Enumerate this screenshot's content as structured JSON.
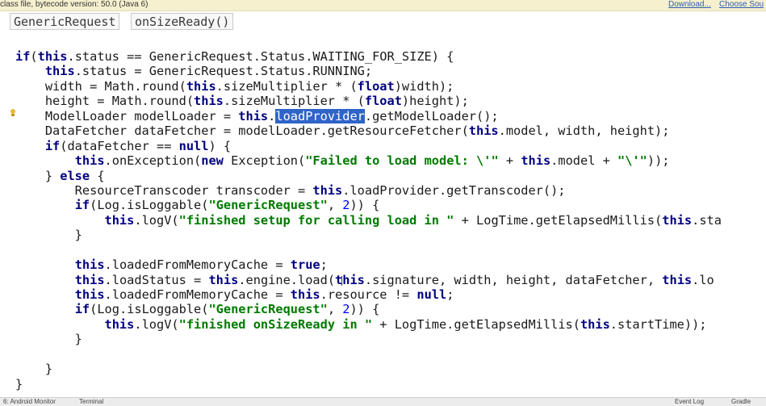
{
  "notice": {
    "message": "class file, bytecode version: 50.0 (Java 6)",
    "download_label": "Download...",
    "choose_sources_label": "Choose Sou"
  },
  "breadcrumb": [
    "GenericRequest",
    "onSizeReady()"
  ],
  "code_lines": [
    [
      [
        "if",
        "kw"
      ],
      [
        "(",
        ""
      ],
      [
        "this",
        "kw"
      ],
      [
        ".status == GenericRequest.Status.WAITING_FOR_SIZE) {",
        ""
      ]
    ],
    [
      [
        "    ",
        ""
      ],
      [
        "this",
        "kw"
      ],
      [
        ".status = GenericRequest.Status.RUNNING;",
        ""
      ]
    ],
    [
      [
        "    width = Math.round(",
        ""
      ],
      [
        "this",
        "kw"
      ],
      [
        ".sizeMultiplier * (",
        ""
      ],
      [
        "float",
        "kw"
      ],
      [
        ")width);",
        ""
      ]
    ],
    [
      [
        "    height = Math.round(",
        ""
      ],
      [
        "this",
        "kw"
      ],
      [
        ".sizeMultiplier * (",
        ""
      ],
      [
        "float",
        "kw"
      ],
      [
        ")height);",
        ""
      ]
    ],
    [
      [
        "    ModelLoader modelLoader = ",
        ""
      ],
      [
        "this",
        "kw"
      ],
      [
        ".",
        ""
      ],
      [
        "loadProvider",
        "sel"
      ],
      [
        ".getModelLoader();",
        ""
      ]
    ],
    [
      [
        "    DataFetcher dataFetcher = modelLoader.getResourceFetcher(",
        ""
      ],
      [
        "this",
        "kw"
      ],
      [
        ".model, width, height);",
        ""
      ]
    ],
    [
      [
        "    ",
        ""
      ],
      [
        "if",
        "kw"
      ],
      [
        "(dataFetcher == ",
        ""
      ],
      [
        "null",
        "kw"
      ],
      [
        ") {",
        ""
      ]
    ],
    [
      [
        "        ",
        ""
      ],
      [
        "this",
        "kw"
      ],
      [
        ".onException(",
        ""
      ],
      [
        "new",
        "kw"
      ],
      [
        " Exception(",
        ""
      ],
      [
        "\"Failed to load model: \\'\"",
        "str"
      ],
      [
        " + ",
        ""
      ],
      [
        "this",
        "kw"
      ],
      [
        ".model + ",
        ""
      ],
      [
        "\"\\'\"",
        "str"
      ],
      [
        "));",
        ""
      ]
    ],
    [
      [
        "    } ",
        ""
      ],
      [
        "else",
        "kw"
      ],
      [
        " {",
        ""
      ]
    ],
    [
      [
        "        ResourceTranscoder transcoder = ",
        ""
      ],
      [
        "this",
        "kw"
      ],
      [
        ".loadProvider.getTranscoder();",
        ""
      ]
    ],
    [
      [
        "        ",
        ""
      ],
      [
        "if",
        "kw"
      ],
      [
        "(Log.isLoggable(",
        ""
      ],
      [
        "\"GenericRequest\"",
        "str"
      ],
      [
        ", ",
        ""
      ],
      [
        "2",
        "num"
      ],
      [
        ")) {",
        ""
      ]
    ],
    [
      [
        "            ",
        ""
      ],
      [
        "this",
        "kw"
      ],
      [
        ".logV(",
        ""
      ],
      [
        "\"finished setup for calling load in \"",
        "str"
      ],
      [
        " + LogTime.getElapsedMillis(",
        ""
      ],
      [
        "this",
        "kw"
      ],
      [
        ".sta",
        ""
      ]
    ],
    [
      [
        "        }",
        ""
      ]
    ],
    [
      [
        "",
        ""
      ]
    ],
    [
      [
        "        ",
        ""
      ],
      [
        "this",
        "kw"
      ],
      [
        ".loadedFromMemoryCache = ",
        ""
      ],
      [
        "true",
        "kw"
      ],
      [
        ";",
        ""
      ]
    ],
    [
      [
        "        ",
        ""
      ],
      [
        "this",
        "kw"
      ],
      [
        ".loadStatus = ",
        ""
      ],
      [
        "this",
        "kw"
      ],
      [
        ".engine.load(",
        ""
      ],
      [
        "this",
        "kw"
      ],
      [
        ".signature, width, height, dataFetcher, ",
        ""
      ],
      [
        "this",
        "kw"
      ],
      [
        ".lo",
        ""
      ]
    ],
    [
      [
        "        ",
        ""
      ],
      [
        "this",
        "kw"
      ],
      [
        ".loadedFromMemoryCache = ",
        ""
      ],
      [
        "this",
        "kw"
      ],
      [
        ".resource != ",
        ""
      ],
      [
        "null",
        "kw"
      ],
      [
        ";",
        ""
      ]
    ],
    [
      [
        "        ",
        ""
      ],
      [
        "if",
        "kw"
      ],
      [
        "(Log.isLoggable(",
        ""
      ],
      [
        "\"GenericRequest\"",
        "str"
      ],
      [
        ", ",
        ""
      ],
      [
        "2",
        "num"
      ],
      [
        ")) {",
        ""
      ]
    ],
    [
      [
        "            ",
        ""
      ],
      [
        "this",
        "kw"
      ],
      [
        ".logV(",
        ""
      ],
      [
        "\"finished onSizeReady in \"",
        "str"
      ],
      [
        " + LogTime.getElapsedMillis(",
        ""
      ],
      [
        "this",
        "kw"
      ],
      [
        ".startTime));",
        ""
      ]
    ],
    [
      [
        "        }",
        ""
      ]
    ],
    [
      [
        "",
        ""
      ]
    ],
    [
      [
        "    }",
        ""
      ]
    ],
    [
      [
        "}",
        ""
      ]
    ]
  ],
  "status_bar": {
    "left_items": [
      "6: Android Monitor",
      "Terminal"
    ],
    "right_items": [
      "Event Log",
      "Gradle"
    ]
  }
}
